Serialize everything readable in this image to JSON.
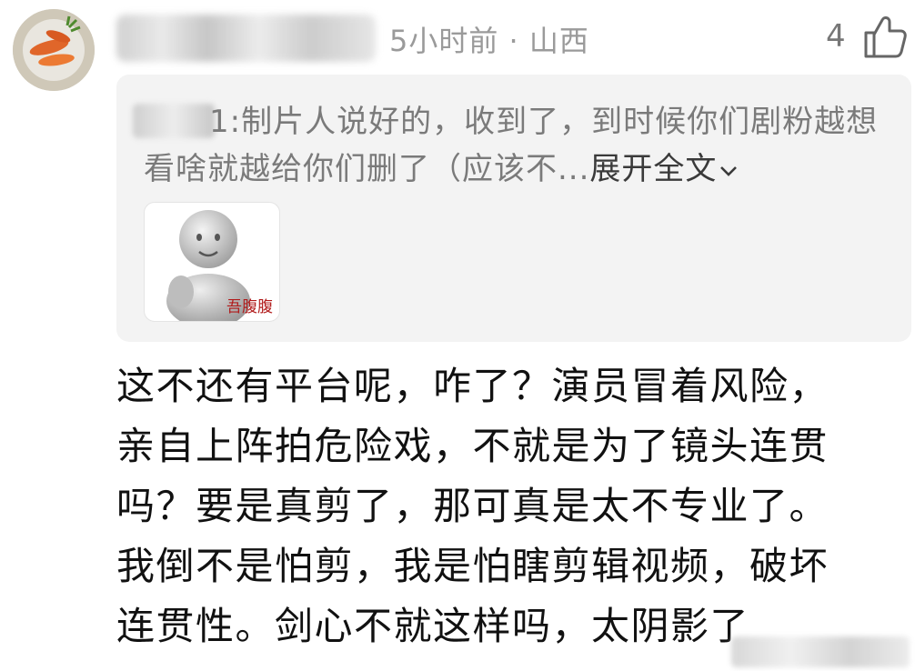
{
  "comment": {
    "meta": "5小时前 · 山西",
    "like_count": "4",
    "like_icon": "thumbs-up-icon"
  },
  "quote": {
    "username_suffix": "1:",
    "text": "制片人说好的，收到了，到时候你们剧粉越想看啥就越给你们删了（应该不...",
    "expand_label": "展开全文",
    "sticker_label": "吾腹腹"
  },
  "body": {
    "lines": [
      "这不还有平台呢，咋了？演员冒着风险，",
      "亲自上阵拍危险戏，不就是为了镜头连贯",
      "吗？要是真剪了，那可真是太不专业了。",
      "我倒不是怕剪，我是怕瞎剪辑视频，破坏",
      "连贯性。剑心不就这样吗，太阴影了"
    ]
  },
  "colors": {
    "meta_gray": "#9a9a9a",
    "quote_bg": "#f3f3f3",
    "quote_text": "#7a7a7a",
    "sticker_text": "#b11b1b"
  }
}
